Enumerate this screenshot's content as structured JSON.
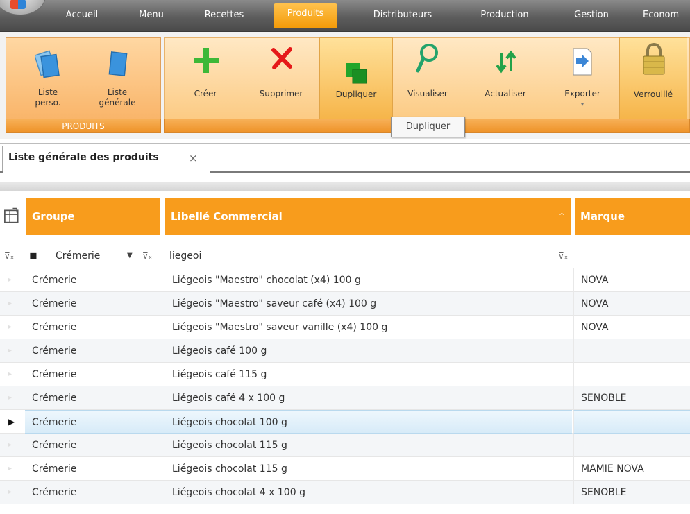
{
  "menu": {
    "items": [
      {
        "label": "Accueil",
        "active": false
      },
      {
        "label": "Menu",
        "active": false
      },
      {
        "label": "Recettes",
        "active": false
      },
      {
        "label": "Produits",
        "active": true
      },
      {
        "label": "Distributeurs",
        "active": false
      },
      {
        "label": "Production",
        "active": false
      },
      {
        "label": "Gestion",
        "active": false
      },
      {
        "label": "Econom",
        "active": false
      }
    ]
  },
  "ribbon": {
    "produits_group": {
      "label": "PRODUITS",
      "buttons": [
        {
          "line1": "Liste",
          "line2": "perso.",
          "icon": "custom-list-icon"
        },
        {
          "line1": "Liste",
          "line2": "générale",
          "icon": "general-list-icon"
        }
      ]
    },
    "actions": [
      {
        "label": "Créer",
        "icon": "plus-icon"
      },
      {
        "label": "Supprimer",
        "icon": "delete-x-icon"
      },
      {
        "label": "Dupliquer",
        "icon": "duplicate-icon",
        "highlighted": true
      },
      {
        "label": "Visualiser",
        "icon": "magnifier-icon"
      },
      {
        "label": "Actualiser",
        "icon": "refresh-arrows-icon"
      },
      {
        "label": "Exporter",
        "icon": "export-icon",
        "dropdown": true
      },
      {
        "label": "Verrouillé",
        "icon": "padlock-icon",
        "highlighted": true
      }
    ],
    "tooltip": "Dupliquer"
  },
  "document_tab": {
    "title": "Liste générale des produits",
    "close_glyph": "×"
  },
  "grid": {
    "columns": [
      "Groupe",
      "Libellé Commercial",
      "Marque"
    ],
    "sort_indicator": "^",
    "filters": {
      "groupe_value": "Crémerie",
      "libelle_value": "liegeoi",
      "marque_value": ""
    },
    "rows": [
      {
        "groupe": "Crémerie",
        "libelle": "Liégeois \"Maestro\" chocolat (x4) 100 g",
        "marque": "NOVA",
        "selected": false
      },
      {
        "groupe": "Crémerie",
        "libelle": "Liégeois \"Maestro\" saveur café (x4) 100 g",
        "marque": "NOVA",
        "selected": false
      },
      {
        "groupe": "Crémerie",
        "libelle": "Liégeois \"Maestro\" saveur vanille (x4) 100 g",
        "marque": "NOVA",
        "selected": false
      },
      {
        "groupe": "Crémerie",
        "libelle": "Liégeois café 100 g",
        "marque": "",
        "selected": false
      },
      {
        "groupe": "Crémerie",
        "libelle": "Liégeois café 115 g",
        "marque": "",
        "selected": false
      },
      {
        "groupe": "Crémerie",
        "libelle": "Liégeois café 4 x 100 g",
        "marque": "SENOBLE",
        "selected": false
      },
      {
        "groupe": "Crémerie",
        "libelle": "Liégeois chocolat 100 g",
        "marque": "",
        "selected": true
      },
      {
        "groupe": "Crémerie",
        "libelle": "Liégeois chocolat 115 g",
        "marque": "",
        "selected": false
      },
      {
        "groupe": "Crémerie",
        "libelle": "Liégeois chocolat 115 g",
        "marque": "MAMIE NOVA",
        "selected": false
      },
      {
        "groupe": "Crémerie",
        "libelle": "Liégeois chocolat 4 x 100 g",
        "marque": "SENOBLE",
        "selected": false
      }
    ]
  },
  "colors": {
    "accent_orange": "#f89c1c",
    "selection_blue": "#d7ebf8"
  }
}
